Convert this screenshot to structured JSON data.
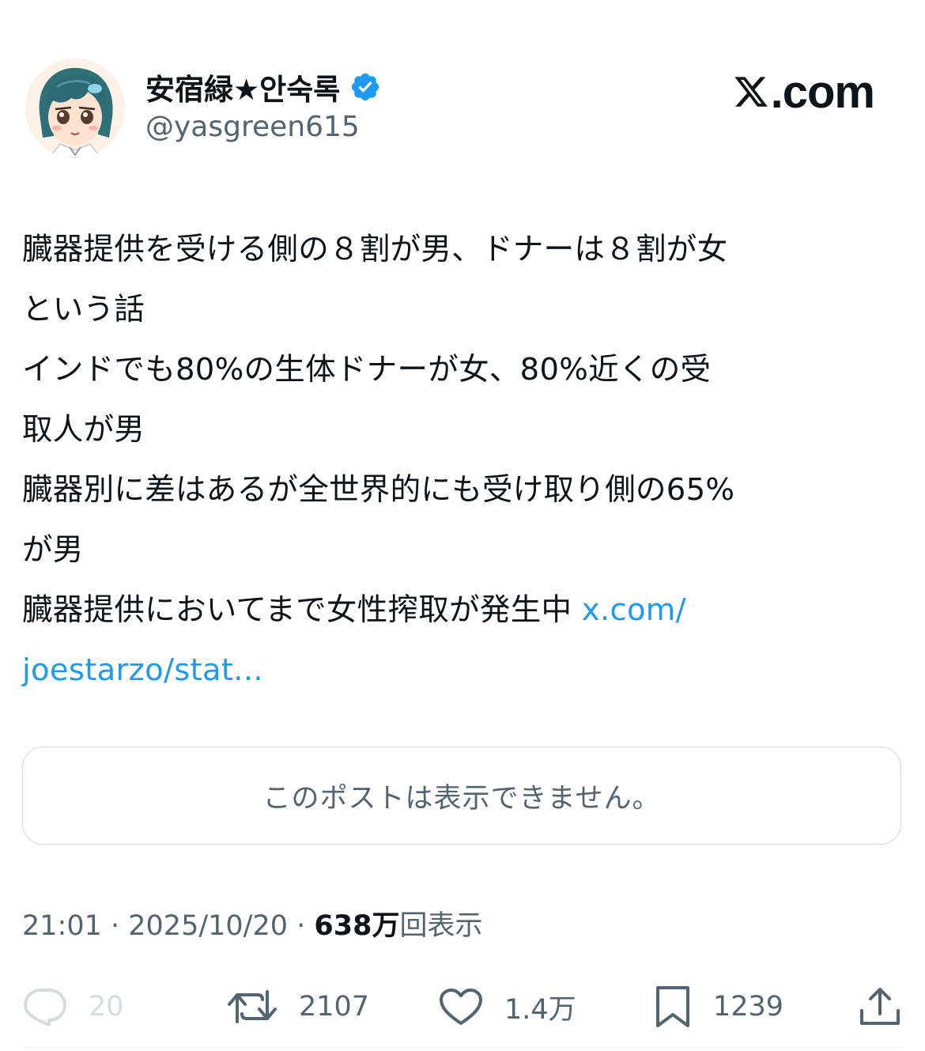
{
  "user": {
    "display_name": "安宿緑★안숙록",
    "handle": "@yasgreen615",
    "verified_icon": "verified-badge-icon",
    "avatar_icon": "anime-avatar"
  },
  "brand": {
    "logo_text": ".com",
    "logo_icon": "x-logo-icon"
  },
  "tweet": {
    "lines": [
      "臓器提供を受ける側の８割が男、ドナーは８割が女",
      "という話",
      "インドでも80%の生体ドナーが女、80%近くの受",
      "取人が男",
      "臓器別に差はあるが全世界的にも受け取り側の65%",
      "が男",
      "臓器提供においてまで女性搾取が発生中 "
    ],
    "link_part1": "x.com/",
    "link_part2": "joestarzo/stat..."
  },
  "quote": {
    "unavailable_text": "このポストは表示できません。"
  },
  "meta": {
    "time": "21:01",
    "separator": " · ",
    "date": "2025/10/20",
    "views_num": "638万",
    "views_label": "回表示"
  },
  "actions": {
    "reply_count": "20",
    "repost_count": "2107",
    "like_count": "1.4万",
    "bookmark_count": "1239"
  },
  "colors": {
    "link": "#1d9bf0",
    "verified": "#1d9bf0",
    "secondary_text": "#536471",
    "border": "#cfd9de"
  }
}
